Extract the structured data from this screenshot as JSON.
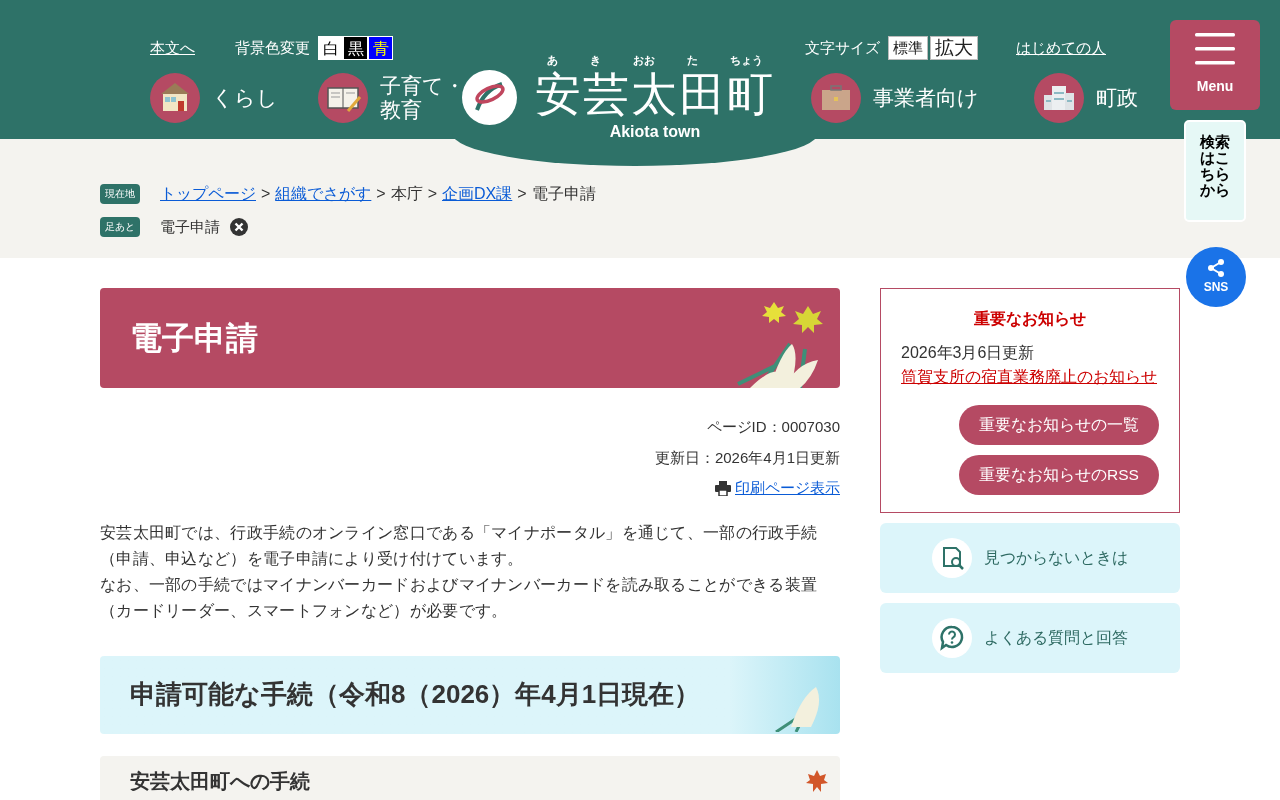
{
  "header": {
    "skip_link": "本文へ",
    "bg_color_label": "背景色変更",
    "bg_colors": [
      {
        "label": "白",
        "color": "#ffffff"
      },
      {
        "label": "黒",
        "color": "#000000"
      },
      {
        "label": "青",
        "color": "#0000ff"
      }
    ],
    "font_size_label": "文字サイズ",
    "font_sizes": [
      "標準",
      "拡大"
    ],
    "first_visit": "はじめての人",
    "nav_left": [
      "くらし",
      "子育て・教育"
    ],
    "nav_right": [
      "事業者向け",
      "町政"
    ],
    "logo": {
      "ruby": [
        "あ",
        "き",
        "おお",
        "た",
        "ちょう"
      ],
      "title": "安芸太田町",
      "subtitle": "Akiota town"
    },
    "menu": "Menu",
    "search_tip": "検索はこちらから",
    "sns": "SNS"
  },
  "breadcrumb": {
    "label": "現在地",
    "items": [
      {
        "text": "トップページ",
        "kind": "link"
      },
      {
        "text": ">",
        "kind": "separator"
      },
      {
        "text": "組織でさがす",
        "kind": "link"
      },
      {
        "text": ">",
        "kind": "separator"
      },
      {
        "text": "本庁",
        "kind": "text"
      },
      {
        "text": ">",
        "kind": "separator"
      },
      {
        "text": "企画DX課",
        "kind": "link"
      },
      {
        "text": ">",
        "kind": "separator"
      },
      {
        "text": "電子申請",
        "kind": "text"
      }
    ]
  },
  "footprint": {
    "label": "足あと",
    "items": [
      "電子申請"
    ]
  },
  "page": {
    "title": "電子申請",
    "page_id": "ページID：0007030",
    "updated": "更新日：2026年4月1日更新",
    "print": "印刷ページ表示",
    "paragraphs": [
      "安芸太田町では、行政手続のオンライン窓口である「マイナポータル」を通じて、一部の行政手続（申請、申込など）を電子申請により受け付けています。",
      "なお、一部の手続ではマイナンバーカードおよびマイナンバーカードを読み取ることができる装置（カードリーダー、スマートフォンなど）が必要です。"
    ],
    "heading2": "申請可能な手続（令和8（2026）年4月1日現在）",
    "heading3": "安芸太田町への手続"
  },
  "notice": {
    "title": "重要なお知らせ",
    "date": "2026年3月6日更新",
    "link": "筒賀支所の宿直業務廃止のお知らせ",
    "buttons": [
      "重要なお知らせの一覧",
      "重要なお知らせのRSS"
    ]
  },
  "side_links": [
    "見つからないときは",
    "よくある質問と回答"
  ]
}
